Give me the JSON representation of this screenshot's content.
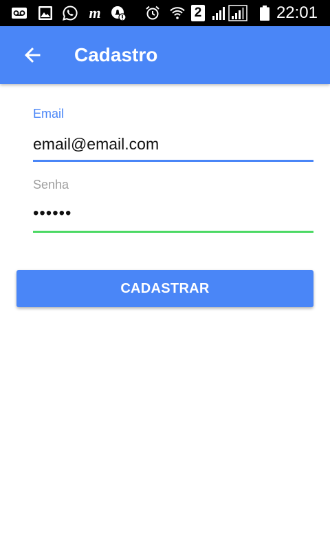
{
  "status_bar": {
    "time": "22:01",
    "sim_label": "2",
    "icons": [
      "voicemail-icon",
      "image-icon",
      "whatsapp-icon",
      "m-icon",
      "notification-icon",
      "alarm-icon",
      "wifi-icon",
      "sim-2-icon",
      "signal-icon",
      "signal-icon",
      "battery-icon"
    ]
  },
  "app_bar": {
    "back_icon": "arrow-left-icon",
    "title": "Cadastro",
    "color": "#4a86f7"
  },
  "form": {
    "email": {
      "label": "Email",
      "value": "email@email.com",
      "underline_color": "#4a86f7"
    },
    "password": {
      "label": "Senha",
      "value": "••••••",
      "underline_color": "#4cd964"
    },
    "submit_label": "CADASTRAR"
  }
}
